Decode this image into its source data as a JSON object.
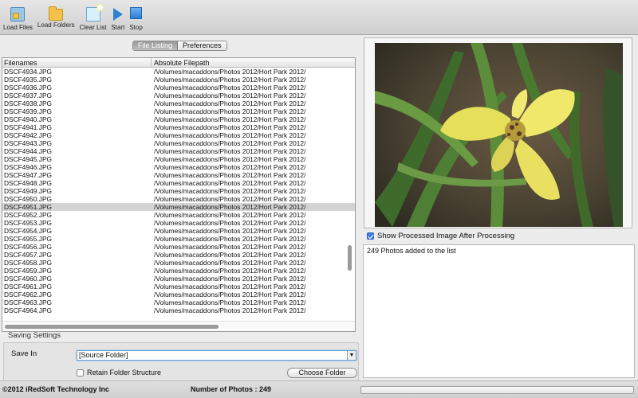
{
  "toolbar": {
    "load_files": "Load Files",
    "load_folders": "Load Folders",
    "clear_list": "Clear List",
    "start": "Start",
    "stop": "Stop"
  },
  "tabs": {
    "file_listing": "File Listing",
    "preferences": "Preferences"
  },
  "table": {
    "col_filenames": "Filenames",
    "col_path": "Absolute Filepath",
    "selected_row": "DSCF4951.JPG",
    "rows": [
      {
        "name": "DSCF4934.JPG",
        "path": "/Volumes/macaddons/Photos 2012/Hort Park 2012/"
      },
      {
        "name": "DSCF4935.JPG",
        "path": "/Volumes/macaddons/Photos 2012/Hort Park 2012/"
      },
      {
        "name": "DSCF4936.JPG",
        "path": "/Volumes/macaddons/Photos 2012/Hort Park 2012/"
      },
      {
        "name": "DSCF4937.JPG",
        "path": "/Volumes/macaddons/Photos 2012/Hort Park 2012/"
      },
      {
        "name": "DSCF4938.JPG",
        "path": "/Volumes/macaddons/Photos 2012/Hort Park 2012/"
      },
      {
        "name": "DSCF4939.JPG",
        "path": "/Volumes/macaddons/Photos 2012/Hort Park 2012/"
      },
      {
        "name": "DSCF4940.JPG",
        "path": "/Volumes/macaddons/Photos 2012/Hort Park 2012/"
      },
      {
        "name": "DSCF4941.JPG",
        "path": "/Volumes/macaddons/Photos 2012/Hort Park 2012/"
      },
      {
        "name": "DSCF4942.JPG",
        "path": "/Volumes/macaddons/Photos 2012/Hort Park 2012/"
      },
      {
        "name": "DSCF4943.JPG",
        "path": "/Volumes/macaddons/Photos 2012/Hort Park 2012/"
      },
      {
        "name": "DSCF4944.JPG",
        "path": "/Volumes/macaddons/Photos 2012/Hort Park 2012/"
      },
      {
        "name": "DSCF4945.JPG",
        "path": "/Volumes/macaddons/Photos 2012/Hort Park 2012/"
      },
      {
        "name": "DSCF4946.JPG",
        "path": "/Volumes/macaddons/Photos 2012/Hort Park 2012/"
      },
      {
        "name": "DSCF4947.JPG",
        "path": "/Volumes/macaddons/Photos 2012/Hort Park 2012/"
      },
      {
        "name": "DSCF4948.JPG",
        "path": "/Volumes/macaddons/Photos 2012/Hort Park 2012/"
      },
      {
        "name": "DSCF4949.JPG",
        "path": "/Volumes/macaddons/Photos 2012/Hort Park 2012/"
      },
      {
        "name": "DSCF4950.JPG",
        "path": "/Volumes/macaddons/Photos 2012/Hort Park 2012/"
      },
      {
        "name": "DSCF4951.JPG",
        "path": "/Volumes/macaddons/Photos 2012/Hort Park 2012/"
      },
      {
        "name": "DSCF4952.JPG",
        "path": "/Volumes/macaddons/Photos 2012/Hort Park 2012/"
      },
      {
        "name": "DSCF4953.JPG",
        "path": "/Volumes/macaddons/Photos 2012/Hort Park 2012/"
      },
      {
        "name": "DSCF4954.JPG",
        "path": "/Volumes/macaddons/Photos 2012/Hort Park 2012/"
      },
      {
        "name": "DSCF4955.JPG",
        "path": "/Volumes/macaddons/Photos 2012/Hort Park 2012/"
      },
      {
        "name": "DSCF4956.JPG",
        "path": "/Volumes/macaddons/Photos 2012/Hort Park 2012/"
      },
      {
        "name": "DSCF4957.JPG",
        "path": "/Volumes/macaddons/Photos 2012/Hort Park 2012/"
      },
      {
        "name": "DSCF4958.JPG",
        "path": "/Volumes/macaddons/Photos 2012/Hort Park 2012/"
      },
      {
        "name": "DSCF4959.JPG",
        "path": "/Volumes/macaddons/Photos 2012/Hort Park 2012/"
      },
      {
        "name": "DSCF4960.JPG",
        "path": "/Volumes/macaddons/Photos 2012/Hort Park 2012/"
      },
      {
        "name": "DSCF4961.JPG",
        "path": "/Volumes/macaddons/Photos 2012/Hort Park 2012/"
      },
      {
        "name": "DSCF4962.JPG",
        "path": "/Volumes/macaddons/Photos 2012/Hort Park 2012/"
      },
      {
        "name": "DSCF4963.JPG",
        "path": "/Volumes/macaddons/Photos 2012/Hort Park 2012/"
      },
      {
        "name": "DSCF4964.JPG",
        "path": "/Volumes/macaddons/Photos 2012/Hort Park 2012/"
      }
    ]
  },
  "saving": {
    "title": "Saving Settings",
    "save_in_label": "Save In",
    "save_in_value": "[Source Folder]",
    "retain_label": "Retain Folder Structure",
    "retain_checked": false,
    "choose_folder": "Choose Folder"
  },
  "preview": {
    "show_processed_label": "Show Processed Image After Processing",
    "show_processed_checked": true
  },
  "log": {
    "message": "249 Photos added to the list"
  },
  "status": {
    "copyright": "©2012 iRedSoft Technology Inc",
    "photo_count": "Number of Photos : 249",
    "progress_fraction": 0
  }
}
